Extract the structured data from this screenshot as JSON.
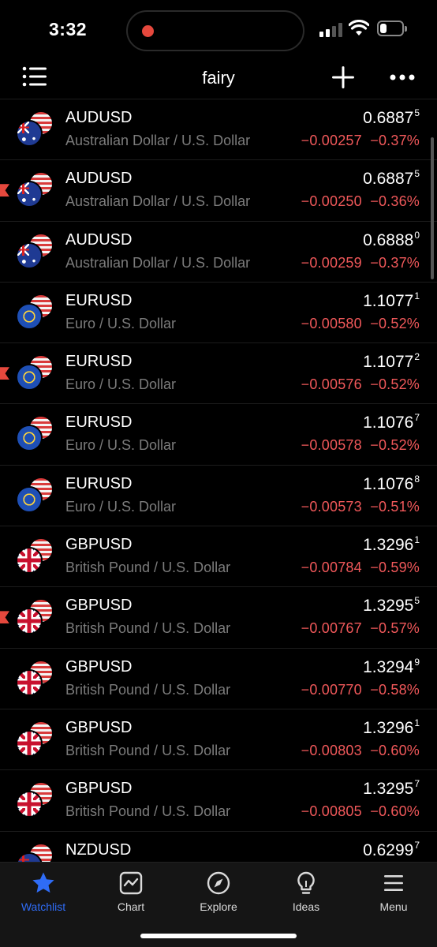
{
  "status": {
    "time": "3:32",
    "battery_level": 0.3
  },
  "nav": {
    "title": "fairy"
  },
  "rows": [
    {
      "symbol": "AUDUSD",
      "desc": "Australian Dollar / U.S. Dollar",
      "price": "0.6887",
      "price_sup": "5",
      "change": "−0.00257",
      "change_pct": "−0.37%",
      "flag": "aud",
      "marked": false
    },
    {
      "symbol": "AUDUSD",
      "desc": "Australian Dollar / U.S. Dollar",
      "price": "0.6887",
      "price_sup": "5",
      "change": "−0.00250",
      "change_pct": "−0.36%",
      "flag": "aud",
      "marked": true
    },
    {
      "symbol": "AUDUSD",
      "desc": "Australian Dollar / U.S. Dollar",
      "price": "0.6888",
      "price_sup": "0",
      "change": "−0.00259",
      "change_pct": "−0.37%",
      "flag": "aud",
      "marked": false
    },
    {
      "symbol": "EURUSD",
      "desc": "Euro / U.S. Dollar",
      "price": "1.1077",
      "price_sup": "1",
      "change": "−0.00580",
      "change_pct": "−0.52%",
      "flag": "eur",
      "marked": false
    },
    {
      "symbol": "EURUSD",
      "desc": "Euro / U.S. Dollar",
      "price": "1.1077",
      "price_sup": "2",
      "change": "−0.00576",
      "change_pct": "−0.52%",
      "flag": "eur",
      "marked": true
    },
    {
      "symbol": "EURUSD",
      "desc": "Euro / U.S. Dollar",
      "price": "1.1076",
      "price_sup": "7",
      "change": "−0.00578",
      "change_pct": "−0.52%",
      "flag": "eur",
      "marked": false
    },
    {
      "symbol": "EURUSD",
      "desc": "Euro / U.S. Dollar",
      "price": "1.1076",
      "price_sup": "8",
      "change": "−0.00573",
      "change_pct": "−0.51%",
      "flag": "eur",
      "marked": false
    },
    {
      "symbol": "GBPUSD",
      "desc": "British Pound / U.S. Dollar",
      "price": "1.3296",
      "price_sup": "1",
      "change": "−0.00784",
      "change_pct": "−0.59%",
      "flag": "gbp",
      "marked": false
    },
    {
      "symbol": "GBPUSD",
      "desc": "British Pound / U.S. Dollar",
      "price": "1.3295",
      "price_sup": "5",
      "change": "−0.00767",
      "change_pct": "−0.57%",
      "flag": "gbp",
      "marked": true
    },
    {
      "symbol": "GBPUSD",
      "desc": "British Pound / U.S. Dollar",
      "price": "1.3294",
      "price_sup": "9",
      "change": "−0.00770",
      "change_pct": "−0.58%",
      "flag": "gbp",
      "marked": false
    },
    {
      "symbol": "GBPUSD",
      "desc": "British Pound / U.S. Dollar",
      "price": "1.3296",
      "price_sup": "1",
      "change": "−0.00803",
      "change_pct": "−0.60%",
      "flag": "gbp",
      "marked": false
    },
    {
      "symbol": "GBPUSD",
      "desc": "British Pound / U.S. Dollar",
      "price": "1.3295",
      "price_sup": "7",
      "change": "−0.00805",
      "change_pct": "−0.60%",
      "flag": "gbp",
      "marked": false
    },
    {
      "symbol": "NZDUSD",
      "desc": "",
      "price": "0.6299",
      "price_sup": "7",
      "change": "",
      "change_pct": "",
      "flag": "nzd",
      "marked": false
    }
  ],
  "tabs": [
    {
      "label": "Watchlist",
      "icon": "star-icon",
      "active": true
    },
    {
      "label": "Chart",
      "icon": "chart-icon",
      "active": false
    },
    {
      "label": "Explore",
      "icon": "compass-icon",
      "active": false
    },
    {
      "label": "Ideas",
      "icon": "lightbulb-icon",
      "active": false
    },
    {
      "label": "Menu",
      "icon": "menu-icon",
      "active": false
    }
  ],
  "colors": {
    "negative": "#f0585a",
    "accent": "#2f6cf6",
    "marker": "#e5483d"
  }
}
